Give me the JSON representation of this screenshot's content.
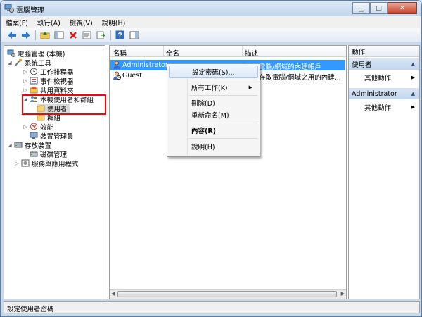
{
  "window": {
    "title": "電腦管理"
  },
  "menu": [
    "檔案(F)",
    "執行(A)",
    "檢視(V)",
    "說明(H)"
  ],
  "toolbar": [
    "back-arrow-icon",
    "forward-arrow-icon",
    "up-folder-icon",
    "show-hide-tree-icon",
    "delete-icon",
    "properties-icon",
    "export-list-icon",
    "help-icon",
    "show-action-pane-icon"
  ],
  "tree": {
    "root": "電腦管理 (本機)",
    "system_tools": "系統工具",
    "task_scheduler": "工作排程器",
    "event_viewer": "事件檢視器",
    "shared_folders": "共用資料夾",
    "local_users_groups": "本機使用者和群組",
    "users": "使用者",
    "groups": "群組",
    "performance": "效能",
    "device_manager": "裝置管理員",
    "storage": "存放裝置",
    "disk_management": "磁碟管理",
    "services_apps": "服務與應用程式"
  },
  "list": {
    "columns": [
      "名稱",
      "全名",
      "描述"
    ],
    "rows": [
      {
        "name": "Administrator",
        "fullname": "",
        "description": "管理電腦/網域的內建帳戶",
        "selected": true
      },
      {
        "name": "Guest",
        "fullname": "",
        "description": "來賓存取電腦/網域之用的內建...",
        "selected": false
      }
    ]
  },
  "context_menu": {
    "set_password": "設定密碼(S)...",
    "all_tasks": "所有工作(K)",
    "delete": "刪除(D)",
    "rename": "重新命名(M)",
    "properties": "內容(R)",
    "help": "說明(H)"
  },
  "actions": {
    "title": "動作",
    "group1": "使用者",
    "more1": "其他動作",
    "group2": "Administrator",
    "more2": "其他動作"
  },
  "status": "設定使用者密碼",
  "colors": {
    "selection": "#3399ff",
    "highlight_box": "#ff0000"
  }
}
